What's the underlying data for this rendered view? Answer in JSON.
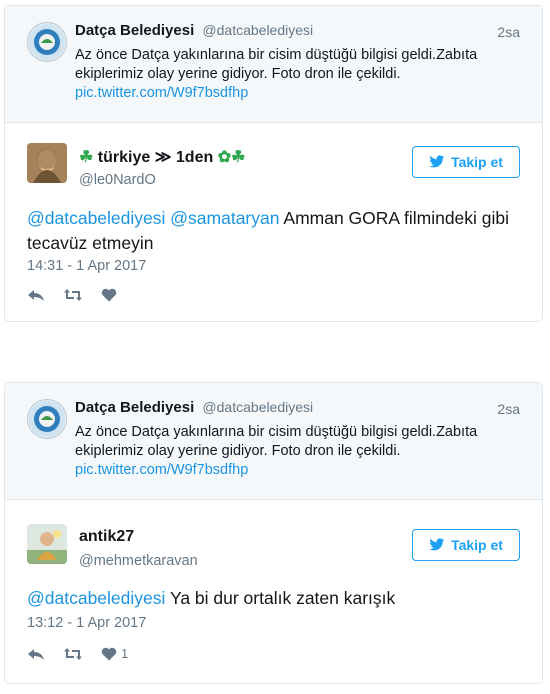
{
  "quoted": {
    "name": "Datça Belediyesi",
    "handle": "@datcabelediyesi",
    "time": "2sa",
    "text": "Az önce Datça yakınlarına bir cisim düştüğü bilgisi geldi.Zabıta ekiplerimiz olay yerine gidiyor. Foto dron ile çekildi.",
    "link": "pic.twitter.com/W9f7bsdfhp"
  },
  "follow_label": "Takip et",
  "replies": [
    {
      "name_prefix": "☘",
      "name": "türkiye ≫ 1den",
      "name_suffix": "✿☘",
      "handle": "@le0NardO",
      "mentions": [
        "@datcabelediyesi",
        "@samataryan"
      ],
      "text": "Amman GORA filmindeki gibi tecavüz etmeyin",
      "timestamp": "14:31 - 1 Apr 2017",
      "like_count": ""
    },
    {
      "name_prefix": "",
      "name": "antik27",
      "name_suffix": "",
      "handle": "@mehmetkaravan",
      "mentions": [
        "@datcabelediyesi"
      ],
      "text": "Ya bi dur ortalık zaten karışık",
      "timestamp": "13:12 - 1 Apr 2017",
      "like_count": "1"
    }
  ],
  "icons": {
    "reply": "reply-icon",
    "retweet": "retweet-icon",
    "like": "heart-icon",
    "bird": "twitter-bird-icon"
  },
  "colors": {
    "link": "#1b95e0",
    "follow": "#1da1f2",
    "muted": "#657786"
  }
}
